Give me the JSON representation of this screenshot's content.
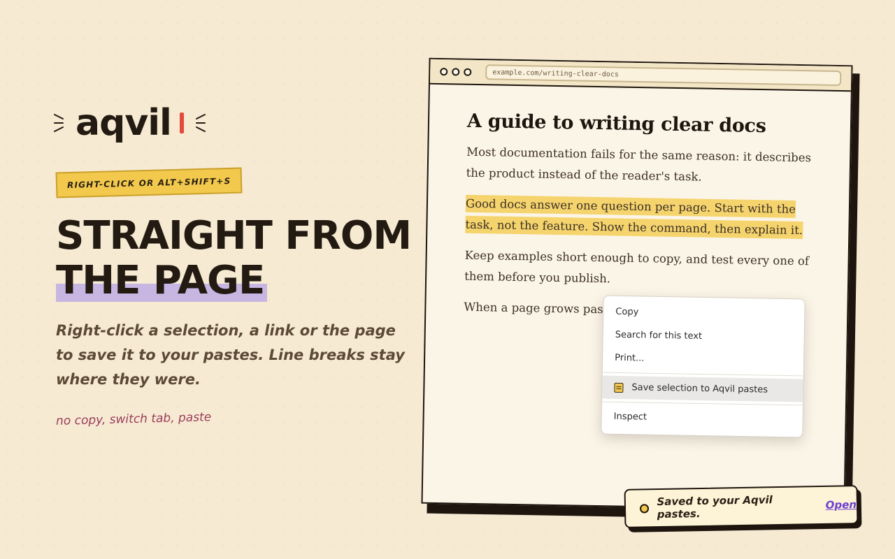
{
  "brand": {
    "name": "aqvil",
    "accent": "#e34a3a"
  },
  "hero": {
    "tag": "Right-click or Alt+Shift+S",
    "headline_line1": "Straight from",
    "headline_line2": "the page",
    "subtitle": "Right-click a selection, a link or the page to save it to your pastes. Line breaks stay where they were.",
    "note": "no copy, switch tab, paste"
  },
  "browser": {
    "url": "example.com/writing-clear-docs",
    "article": {
      "title": "A guide to writing clear docs",
      "p1": "Most documentation fails for the same reason: it describes the product instead of the reader's task.",
      "p2_highlighted": "Good docs answer one question per page. Start with the task, not the feature. Show the command, then explain it.",
      "p3": "Keep examples short enough to copy, and test every one of them before you publish.",
      "p4": "When a page grows past"
    }
  },
  "context_menu": {
    "items": [
      {
        "label": "Copy"
      },
      {
        "label": "Search for this text"
      },
      {
        "label": "Print..."
      },
      {
        "label": "Save selection to Aqvil pastes",
        "icon": "paste-note-icon"
      },
      {
        "label": "Inspect"
      }
    ]
  },
  "toast": {
    "message": "Saved to your Aqvil pastes.",
    "link": "Open"
  },
  "colors": {
    "background": "#f6ead3",
    "highlight": "#f5d46e",
    "underline_band": "#c8b6e2",
    "link": "#6b3fd0"
  }
}
